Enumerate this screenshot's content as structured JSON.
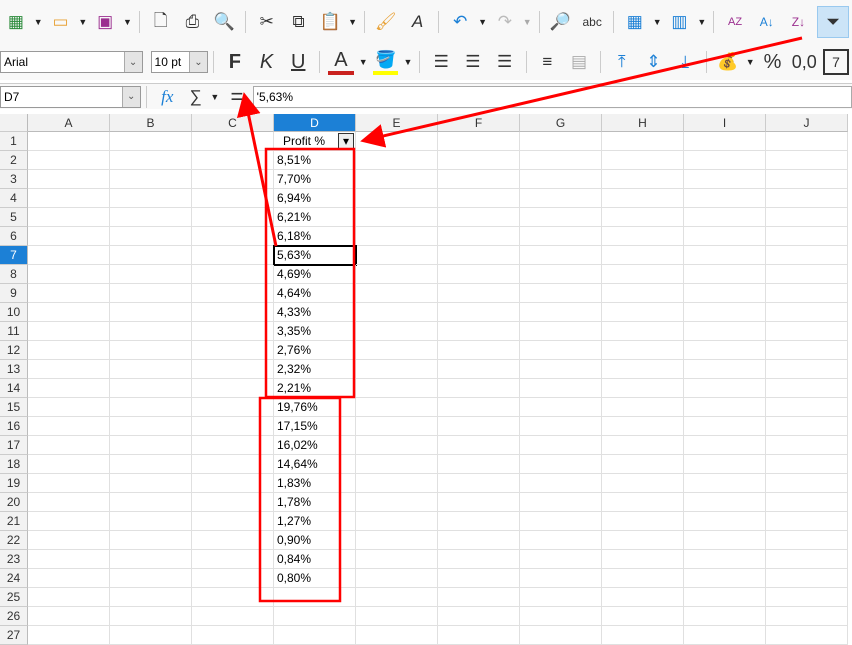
{
  "toolbar1": {
    "icons": [
      "new-spreadsheet-icon",
      "open-folder-icon",
      "save-icon",
      "export-pdf-icon",
      "print-icon",
      "print-preview-icon",
      "cut-icon",
      "copy-icon",
      "paste-icon",
      "clone-formatting-icon",
      "clear-formatting-icon",
      "undo-icon",
      "redo-icon",
      "find-replace-icon",
      "spellcheck-icon",
      "row-icon",
      "column-icon",
      "sort-icon",
      "sort-ascending-icon",
      "sort-descending-icon",
      "autofilter-icon"
    ],
    "spell_label": "abc"
  },
  "toolbar2": {
    "font_name": "Arial",
    "font_size": "10 pt",
    "bold": "F",
    "italic": "K",
    "underline": "U",
    "font_color": "A",
    "percent": "%",
    "decimal": "0,0",
    "date": "7",
    "font_color_hex": "#c9211e",
    "highlight_hex": "#ffff00"
  },
  "formula_bar": {
    "cell_ref": "D7",
    "fx": "fx",
    "sum": "∑",
    "equals": "=",
    "content": "'5,63%"
  },
  "columns": [
    "A",
    "B",
    "C",
    "D",
    "E",
    "F",
    "G",
    "H",
    "I",
    "J"
  ],
  "rows": [
    "1",
    "2",
    "3",
    "4",
    "5",
    "6",
    "7",
    "8",
    "9",
    "10",
    "11",
    "12",
    "13",
    "14",
    "15",
    "16",
    "17",
    "18",
    "19",
    "20",
    "21",
    "22",
    "23",
    "24",
    "25",
    "26",
    "27"
  ],
  "column_d": {
    "header": "Profit %",
    "values": [
      "8,51%",
      "7,70%",
      "6,94%",
      "6,21%",
      "6,18%",
      "5,63%",
      "4,69%",
      "4,64%",
      "4,33%",
      "3,35%",
      "2,76%",
      "2,32%",
      "2,21%",
      "19,76%",
      "17,15%",
      "16,02%",
      "14,64%",
      "1,83%",
      "1,78%",
      "1,27%",
      "0,90%",
      "0,84%",
      "0,80%"
    ]
  },
  "selected_cell": "D7",
  "annotation_color": "#ff0000"
}
